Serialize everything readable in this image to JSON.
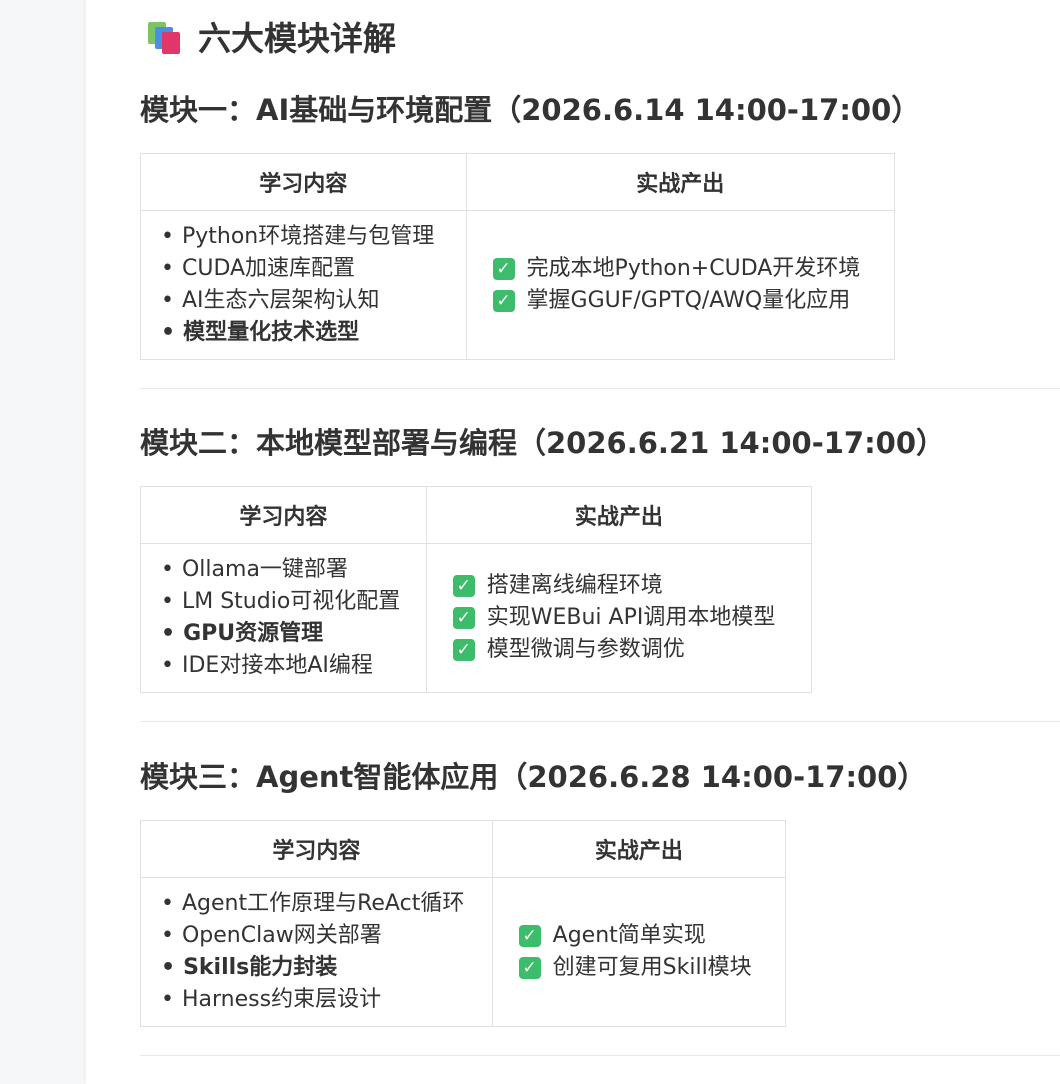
{
  "section": {
    "title": "六大模块详解",
    "icon": "books-icon"
  },
  "modules": [
    {
      "title": "模块一：AI基础与环境配置（2026.6.14 14:00-17:00）",
      "headers": [
        "学习内容",
        "实战产出"
      ],
      "learning": [
        {
          "text": "Python环境搭建与包管理",
          "bold": false
        },
        {
          "text": "CUDA加速库配置",
          "bold": false
        },
        {
          "text": "AI生态六层架构认知",
          "bold": false
        },
        {
          "text": "模型量化技术选型",
          "bold": true
        }
      ],
      "outputs": [
        "完成本地Python+CUDA开发环境",
        "掌握GGUF/GPTQ/AWQ量化应用"
      ]
    },
    {
      "title": "模块二：本地模型部署与编程（2026.6.21 14:00-17:00）",
      "headers": [
        "学习内容",
        "实战产出"
      ],
      "learning": [
        {
          "text": "Ollama一键部署",
          "bold": false
        },
        {
          "text": "LM Studio可视化配置",
          "bold": false
        },
        {
          "text": "GPU资源管理",
          "bold": true
        },
        {
          "text": "IDE对接本地AI编程",
          "bold": false
        }
      ],
      "outputs": [
        "搭建离线编程环境",
        "实现WEBui API调用本地模型",
        "模型微调与参数调优"
      ]
    },
    {
      "title": "模块三：Agent智能体应用（2026.6.28 14:00-17:00）",
      "headers": [
        "学习内容",
        "实战产出"
      ],
      "learning": [
        {
          "text": "Agent工作原理与ReAct循环",
          "bold": false
        },
        {
          "text": "OpenClaw网关部署",
          "bold": false
        },
        {
          "text": "Skills能力封装",
          "bold": true
        },
        {
          "text": "Harness约束层设计",
          "bold": false
        }
      ],
      "outputs": [
        "Agent简单实现",
        "创建可复用Skill模块"
      ]
    }
  ],
  "colors": {
    "text": "#333333",
    "border": "#dfe2e5",
    "check": "#3dbd6b"
  }
}
